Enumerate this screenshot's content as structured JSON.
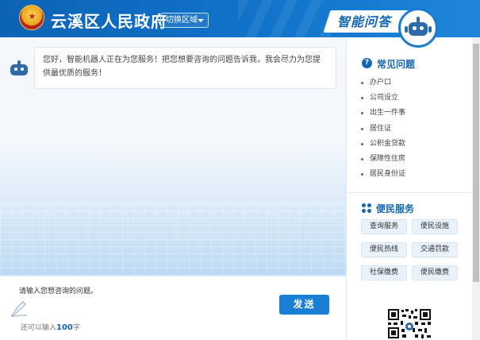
{
  "header": {
    "site_title": "云溪区人民政府",
    "switch_region_label": "切换区域",
    "badge_label": "智能问答"
  },
  "chat": {
    "bot_greeting": "您好，智能机器人正在为您服务！把您想要咨询的问题告诉我，我会尽力为您提供最优质的服务！"
  },
  "input": {
    "prompt": "请输入您想咨询的问题。",
    "counter_prefix": "还可以输入",
    "counter_value": "100",
    "counter_suffix": "字",
    "send_label": "发送"
  },
  "sidebar": {
    "faq_title": "常见问题",
    "faq_items": [
      "办户口",
      "公司设立",
      "出生一件事",
      "居住证",
      "公积金贷款",
      "保障性住房",
      "居民身份证"
    ],
    "services_title": "便民服务",
    "service_buttons": [
      "查询服务",
      "便民设施",
      "便民热线",
      "交通罚款",
      "社保缴费",
      "便民缴费"
    ]
  },
  "colors": {
    "primary": "#1566b3",
    "header_bg": "#1173c9",
    "send_button": "#1a7fd4"
  },
  "icons": {
    "emblem": "national-emblem-icon",
    "robot": "robot-icon",
    "question": "question-circle-icon",
    "services": "four-dots-icon",
    "pen": "pen-icon"
  }
}
